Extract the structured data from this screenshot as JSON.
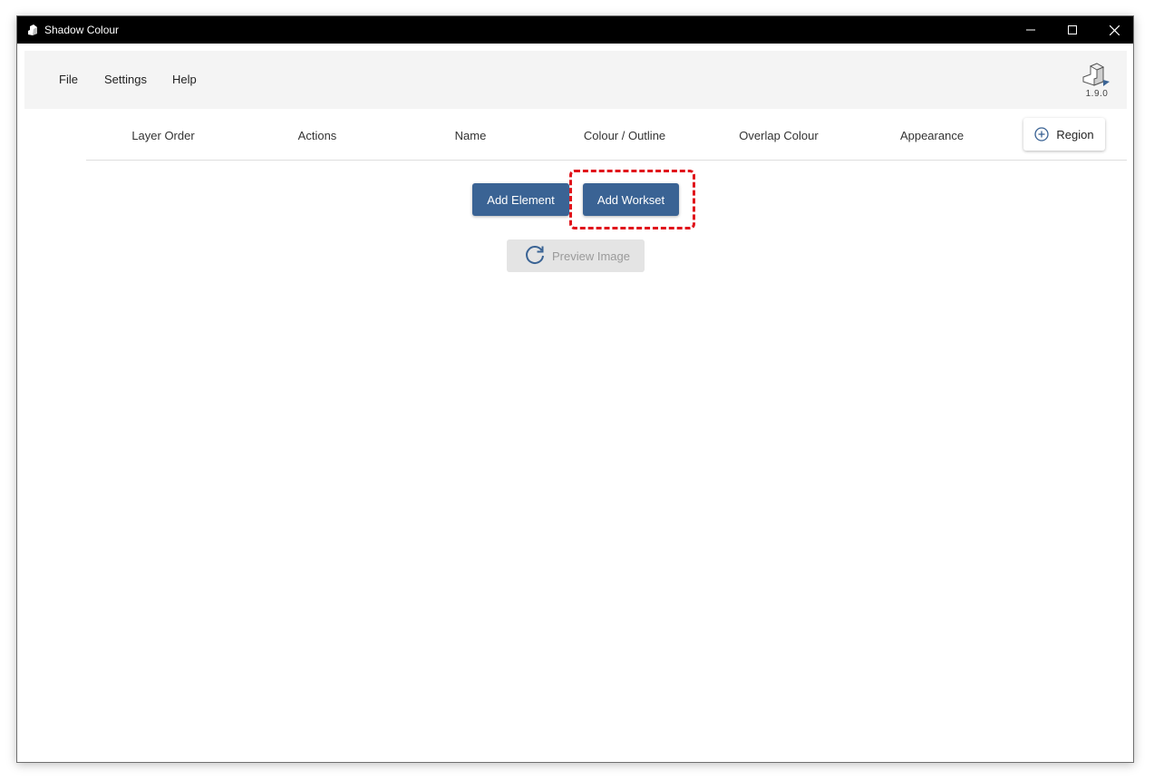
{
  "window": {
    "title": "Shadow Colour"
  },
  "menu": {
    "file": "File",
    "settings": "Settings",
    "help": "Help"
  },
  "version": "1.9.0",
  "columns": {
    "layer_order": "Layer Order",
    "actions": "Actions",
    "name": "Name",
    "colour_outline": "Colour / Outline",
    "overlap_colour": "Overlap Colour",
    "appearance": "Appearance"
  },
  "buttons": {
    "region": "Region",
    "add_element": "Add Element",
    "add_workset": "Add Workset",
    "preview_image": "Preview Image"
  },
  "icons": {
    "region": "plus-circle-icon",
    "preview": "refresh-icon",
    "app": "app-logo-icon"
  },
  "colors": {
    "primary_button": "#3a6394",
    "highlight": "#e0141b",
    "titlebar": "#000000"
  },
  "state": {
    "preview_image_enabled": false,
    "highlighted_control": "Add Workset"
  }
}
